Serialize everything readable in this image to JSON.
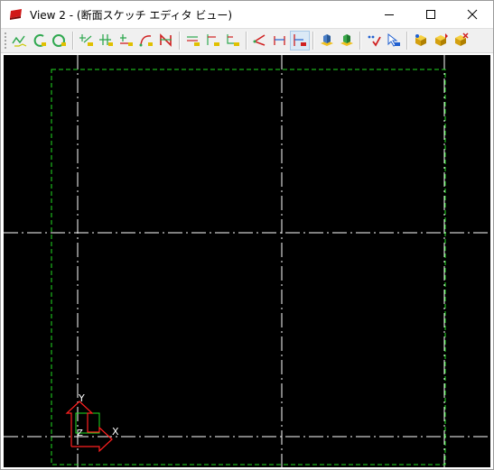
{
  "window": {
    "title": "View 2 - (断面スケッチ エディタ ビュー)",
    "controls": {
      "minimize": "minimize",
      "maximize": "maximize",
      "close": "close"
    }
  },
  "toolbar": {
    "groups": [
      [
        "polyline-icon",
        "arc-tangent-icon",
        "arc-3point-icon"
      ],
      [
        "point-snap-icon",
        "constraint-perpendicular-icon",
        "constraint-offset-icon",
        "curve-edit-icon",
        "trim-icon"
      ],
      [
        "align-horizontal-icon",
        "align-left-icon",
        "align-corner-icon"
      ],
      [
        "dimension-angle-icon",
        "dimension-distance-icon",
        "dimension-vertical-icon"
      ],
      [
        "extrude-solid-icon",
        "extrude-surface-icon"
      ],
      [
        "verify-icon",
        "select-mode-icon"
      ],
      [
        "move-part-icon",
        "copy-part-icon",
        "delete-part-icon"
      ]
    ],
    "active": "dimension-vertical-icon"
  },
  "viewport": {
    "background": "#000000",
    "grid_color": "#ffffff",
    "boundary_color": "#22dd22",
    "axis": {
      "x_label": "X",
      "y_label": "Y",
      "z_label": "Z",
      "x_color": "#ff2020",
      "y_color": "#ff2020",
      "z_color": "#22dd22"
    }
  }
}
